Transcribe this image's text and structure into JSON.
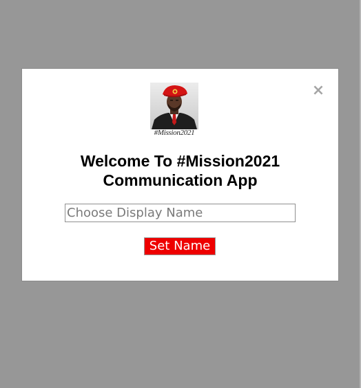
{
  "modal": {
    "close_symbol": "×",
    "logo": {
      "caption": "#Mission2021",
      "icon": "profile-photo-red-beret"
    },
    "heading_line1": "Welcome To #Mission2021",
    "heading_line2": "Communication App",
    "display_name_input": {
      "value": "",
      "placeholder": "Choose Display Name"
    },
    "set_name_label": "Set Name"
  },
  "colors": {
    "overlay": "#979797",
    "modal_background": "#ffffff",
    "button_background": "#ee0000",
    "button_text": "#ffffff",
    "close_icon": "#a5a5a5"
  }
}
